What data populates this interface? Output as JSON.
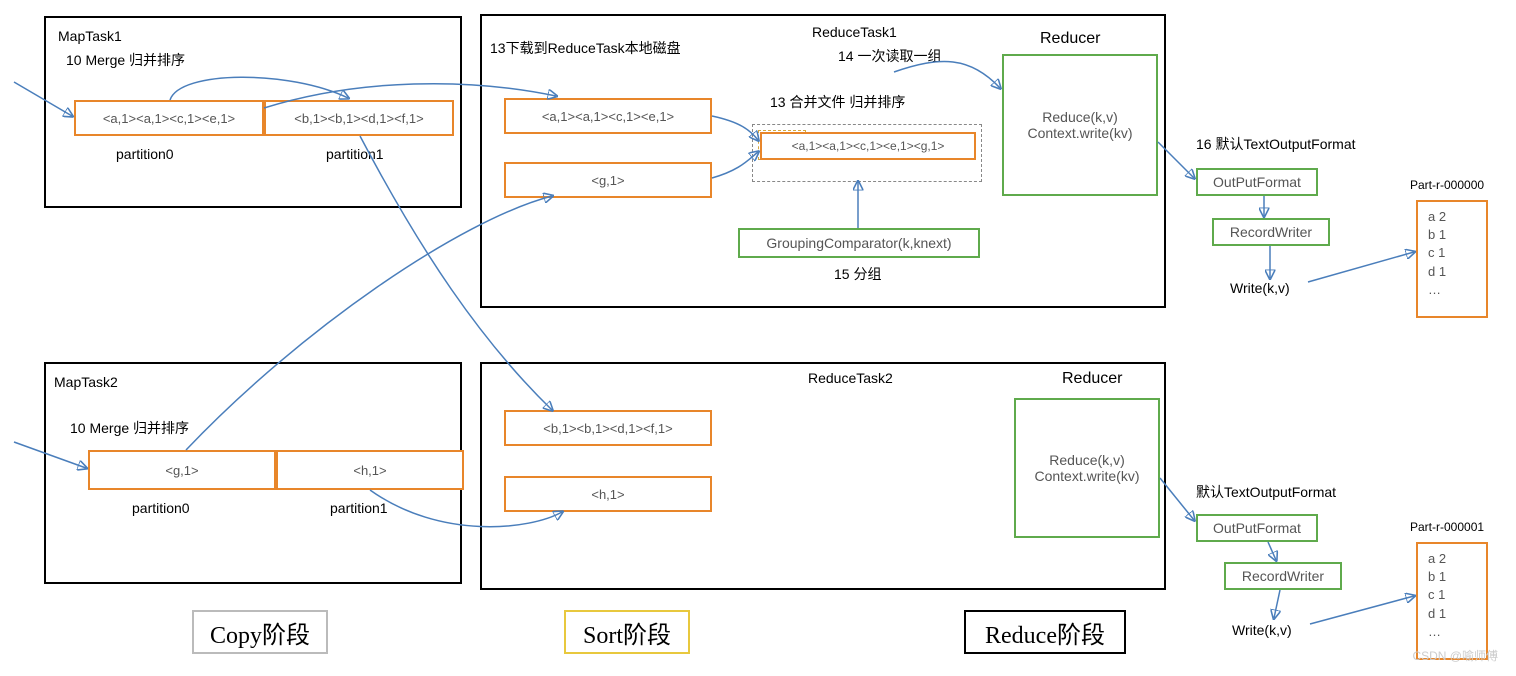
{
  "mapTask1": {
    "title": "MapTask1",
    "mergeLabel": "10 Merge 归并排序",
    "p0": "<a,1><a,1><c,1><e,1>",
    "p1": "<b,1><b,1><d,1><f,1>",
    "p0Label": "partition0",
    "p1Label": "partition1"
  },
  "mapTask2": {
    "title": "MapTask2",
    "mergeLabel": "10 Merge 归并排序",
    "p0": "<g,1>",
    "p1": "<h,1>",
    "p0Label": "partition0",
    "p1Label": "partition1"
  },
  "reduceTask1": {
    "title": "ReduceTask1",
    "downloadLabel": "13下载到ReduceTask本地磁盘",
    "cell1": "<a,1><a,1><c,1><e,1>",
    "cell2": "<g,1>",
    "mergeLabel": "13 合并文件 归并排序",
    "mergedCell": "<a,1><a,1><c,1><e,1><g,1>",
    "reducerTitle": "Reducer",
    "readLabel": "14 一次读取一组",
    "reducerLine1": "Reduce(k,v)",
    "reducerLine2": "Context.write(kv)",
    "groupLabel": "15 分组",
    "groupBox": "GroupingComparator(k,knext)"
  },
  "reduceTask2": {
    "title": "ReduceTask2",
    "cell1": "<b,1><b,1><d,1><f,1>",
    "cell2": "<h,1>",
    "reducerTitle": "Reducer",
    "reducerLine1": "Reduce(k,v)",
    "reducerLine2": "Context.write(kv)"
  },
  "output1": {
    "defLabel": "16 默认TextOutputFormat",
    "opf": "OutPutFormat",
    "rw": "RecordWriter",
    "write": "Write(k,v)",
    "fileTitle": "Part-r-000000",
    "fileLines": [
      "a 2",
      "b 1",
      "c 1",
      "d 1",
      "…"
    ]
  },
  "output2": {
    "defLabel": "默认TextOutputFormat",
    "opf": "OutPutFormat",
    "rw": "RecordWriter",
    "write": "Write(k,v)",
    "fileTitle": "Part-r-000001",
    "fileLines": [
      "a 2",
      "b 1",
      "c 1",
      "d 1",
      "…"
    ]
  },
  "phases": {
    "copy": "Copy阶段",
    "sort": "Sort阶段",
    "reduce": "Reduce阶段"
  },
  "watermark": "CSDN @喻师傅"
}
